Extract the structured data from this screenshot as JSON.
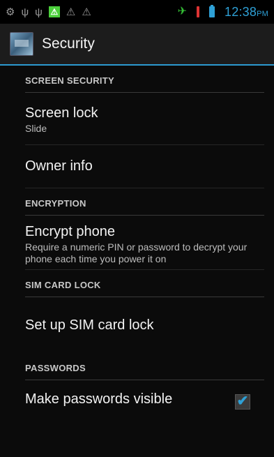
{
  "status_bar": {
    "time": "12:38",
    "ampm": "PM",
    "icons": [
      "android-icon",
      "usb-icon",
      "usb-icon",
      "warning-green-icon",
      "warning-icon",
      "warning-icon",
      "airplane-mode-icon",
      "sim-card-alert-icon",
      "battery-icon"
    ],
    "colors": {
      "accent": "#2ea0d6",
      "green": "#4ccf3c"
    }
  },
  "action_bar": {
    "title": "Security",
    "icon": "settings-app-icon"
  },
  "sections": {
    "screen_security": {
      "header": "SCREEN SECURITY",
      "screen_lock": {
        "title": "Screen lock",
        "summary": "Slide"
      },
      "owner_info": {
        "title": "Owner info"
      }
    },
    "encryption": {
      "header": "ENCRYPTION",
      "encrypt_phone": {
        "title": "Encrypt phone",
        "summary": "Require a numeric PIN or password to decrypt your phone each time you power it on"
      }
    },
    "sim_card_lock": {
      "header": "SIM CARD LOCK",
      "setup": {
        "title": "Set up SIM card lock"
      }
    },
    "passwords": {
      "header": "PASSWORDS",
      "make_visible": {
        "title": "Make passwords visible",
        "checked": true
      }
    }
  }
}
